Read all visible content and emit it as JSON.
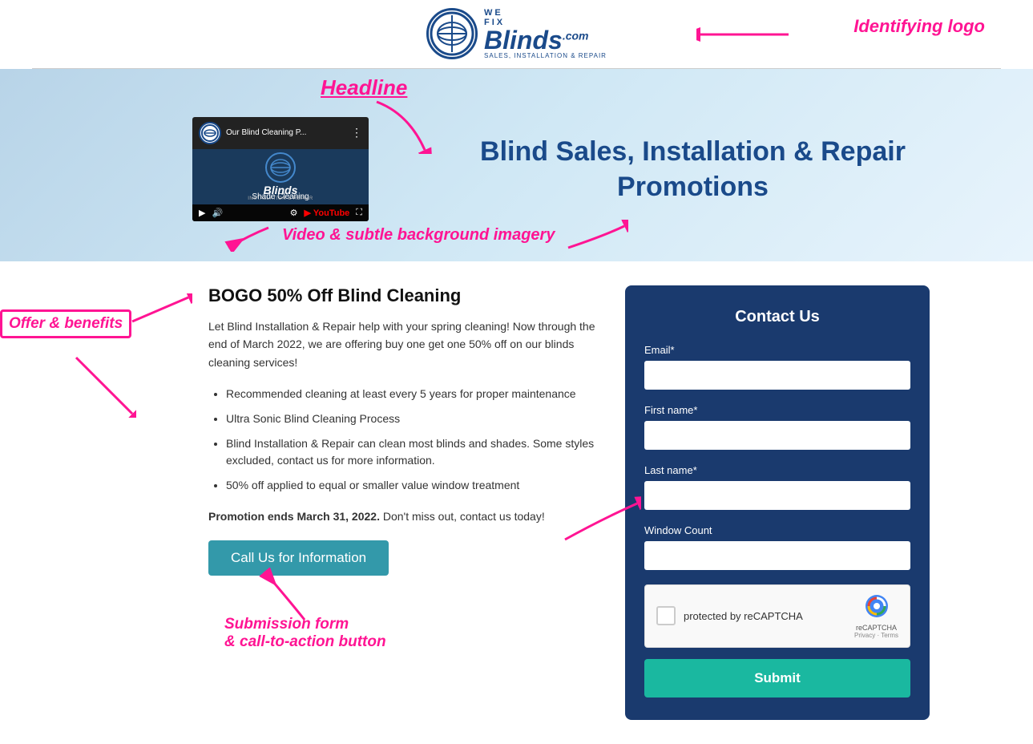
{
  "header": {
    "logo": {
      "we": "WE",
      "fix": "FIX",
      "blinds": "Blinds",
      "com": ".com",
      "sub": "SALES, INSTALLATION & REPAIR"
    },
    "annotation": "Identifying logo"
  },
  "annotations": {
    "headline": "Headline",
    "video_bg": "Video & subtle background imagery",
    "offer_benefits": "Offer & benefits",
    "submission_form": "Submission form\n& call-to-action button"
  },
  "hero": {
    "headline_line1": "Blind Sales, Installation & Repair",
    "headline_line2": "Promotions",
    "video": {
      "title": "Our Blind Cleaning P...",
      "shade_text": "Shade Cleaning",
      "brand": "Blinds",
      "brand_sub": "INSTALLATION & REPAIR"
    }
  },
  "offer": {
    "title": "BOGO 50% Off Blind Cleaning",
    "description": "Let Blind Installation & Repair help with your spring cleaning! Now through the end of March 2022, we are offering buy one get one 50% off on our blinds cleaning services!",
    "bullets": [
      "Recommended cleaning at least every 5 years for proper maintenance",
      "Ultra Sonic Blind Cleaning Process",
      "Blind Installation & Repair can clean most blinds and shades. Some styles excluded, contact us for more information.",
      "50% off applied to equal or smaller value window treatment"
    ],
    "promotion_note_bold": "Promotion ends March 31, 2022.",
    "promotion_note_rest": " Don't miss out, contact us today!",
    "cta_label": "Call Us for Information"
  },
  "form": {
    "title": "Contact Us",
    "email_label": "Email*",
    "email_placeholder": "",
    "firstname_label": "First name*",
    "firstname_placeholder": "",
    "lastname_label": "Last name*",
    "lastname_placeholder": "",
    "window_count_label": "Window Count",
    "window_count_placeholder": "",
    "recaptcha_text": "protected by reCAPTCHA",
    "recaptcha_links": "Privacy · Terms",
    "submit_label": "Submit"
  },
  "colors": {
    "accent_pink": "#ff1493",
    "brand_blue": "#1a4a8a",
    "form_bg": "#1a3a6e",
    "cta_teal": "#3399aa",
    "submit_teal": "#1ab8a0"
  }
}
